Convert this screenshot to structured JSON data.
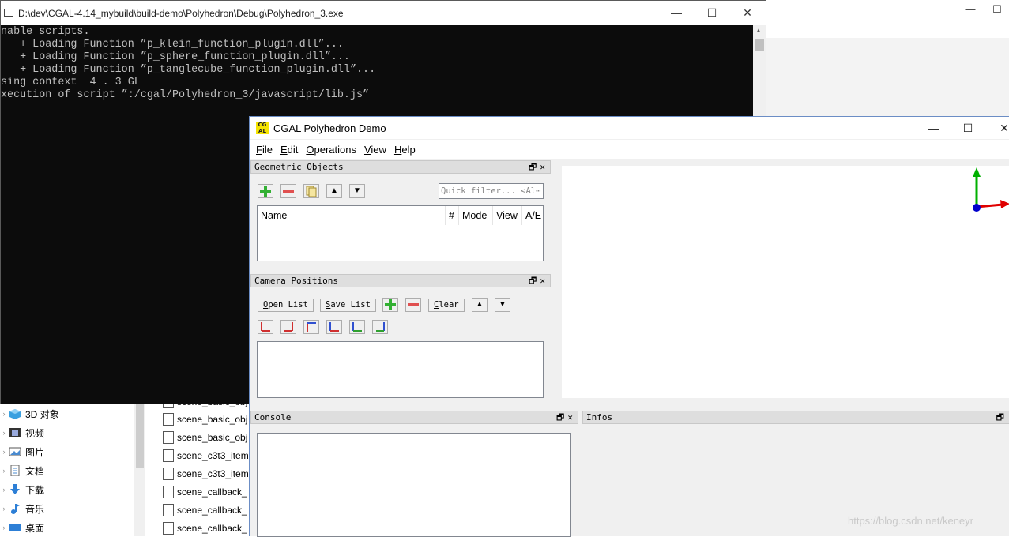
{
  "explorer": {
    "window_controls": [
      "—",
      "☐"
    ],
    "nav_items": [
      {
        "label": "3D 对象",
        "icon": "3d-objects-icon"
      },
      {
        "label": "视频",
        "icon": "video-icon"
      },
      {
        "label": "图片",
        "icon": "pictures-icon"
      },
      {
        "label": "文档",
        "icon": "documents-icon"
      },
      {
        "label": "下载",
        "icon": "downloads-icon"
      },
      {
        "label": "音乐",
        "icon": "music-icon"
      },
      {
        "label": "桌面",
        "icon": "desktop-icon"
      }
    ],
    "files": [
      "scene_basic_obj",
      "scene_basic_obj",
      "scene_basic_obj",
      "scene_c3t3_item",
      "scene_c3t3_item",
      "scene_callback_",
      "scene_callback_",
      "scene_callback_"
    ]
  },
  "console": {
    "title": "D:\\dev\\CGAL-4.14_mybuild\\build-demo\\Polyhedron\\Debug\\Polyhedron_3.exe",
    "lines": [
      "nable scripts.",
      "   + Loading Function ”p_klein_function_plugin.dll”...",
      "   + Loading Function ”p_sphere_function_plugin.dll”...",
      "   + Loading Function ”p_tanglecube_function_plugin.dll”...",
      "sing context  4 . 3 GL",
      "xecution of script ”:/cgal/Polyhedron_3/javascript/lib.js”"
    ],
    "controls": {
      "minimize": "—",
      "maximize": "☐",
      "close": "✕"
    }
  },
  "cgal": {
    "logo_text": "CG AL",
    "title": "CGAL Polyhedron Demo",
    "controls": {
      "minimize": "—",
      "maximize": "☐",
      "close": "✕"
    },
    "menu": [
      "File",
      "Edit",
      "Operations",
      "View",
      "Help"
    ],
    "geometric_objects": {
      "title": "Geometric Objects",
      "dock_buttons": "🗗✕",
      "filter_placeholder": "Quick filter... <Al⋯",
      "columns": [
        "Name",
        "#",
        "Mode",
        "View",
        "A/E"
      ]
    },
    "camera_positions": {
      "title": "Camera Positions",
      "dock_buttons": "🗗✕",
      "open_list": "Open List",
      "save_list": "Save List",
      "clear": "Clear"
    },
    "console_dock": {
      "title": "Console",
      "dock_buttons": "🗗✕"
    },
    "infos_dock": {
      "title": "Infos",
      "dock_buttons": "🗗"
    },
    "axis_colors": {
      "x": "#e00000",
      "y": "#00b000",
      "z": "#0000cc"
    }
  },
  "watermark": "https://blog.csdn.net/keneyr"
}
